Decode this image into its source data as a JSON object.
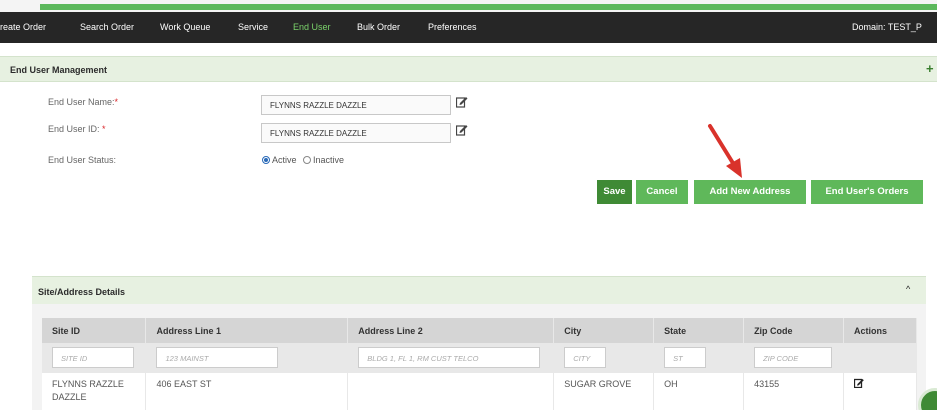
{
  "nav": {
    "items": [
      {
        "label": "reate Order",
        "active": false
      },
      {
        "label": "Search Order",
        "active": false
      },
      {
        "label": "Work Queue",
        "active": false
      },
      {
        "label": "Service",
        "active": false
      },
      {
        "label": "End User",
        "active": true
      },
      {
        "label": "Bulk Order",
        "active": false
      },
      {
        "label": "Preferences",
        "active": false
      }
    ],
    "domain": "Domain: TEST_P"
  },
  "section": {
    "title": "End User Management",
    "expand_symbol": "+"
  },
  "form": {
    "name_label": "End User Name:",
    "name_value": "FLYNNS RAZZLE DAZZLE",
    "id_label": "End User ID:",
    "id_value": "FLYNNS RAZZLE DAZZLE",
    "required_mark": "*",
    "status_label": "End User Status:",
    "status_active": "Active",
    "status_inactive": "Inactive",
    "status_selected": "Active"
  },
  "buttons": {
    "save": "Save",
    "cancel": "Cancel",
    "add_address": "Add New Address",
    "orders": "End User's Orders"
  },
  "colors": {
    "accent_green": "#5fb85a",
    "dark_green": "#3f8a35",
    "annotation_arrow": "#d9322b"
  },
  "site_panel": {
    "title": "Site/Address Details",
    "collapse_symbol": "^",
    "columns": [
      "Site ID",
      "Address Line 1",
      "Address Line 2",
      "City",
      "State",
      "Zip Code",
      "Actions"
    ],
    "filter_placeholders": [
      "SITE ID",
      "123 MAINST",
      "BLDG 1, FL 1, RM CUST TELCO",
      "CITY",
      "ST",
      "ZIP CODE"
    ],
    "rows": [
      {
        "site_id": "FLYNNS RAZZLE DAZZLE",
        "address1": "406 EAST ST",
        "address2": "",
        "city": "SUGAR GROVE",
        "state": "OH",
        "zip": "43155"
      }
    ]
  }
}
